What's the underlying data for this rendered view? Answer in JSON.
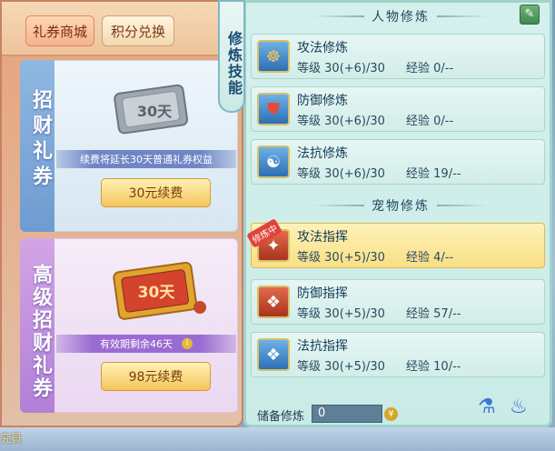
{
  "shop": {
    "tabs": [
      {
        "label": "礼券商城",
        "active": true
      },
      {
        "label": "积分兑换",
        "active": false
      }
    ],
    "cards": [
      {
        "title": "招财礼券",
        "ticket_text": "30天",
        "description": "续费将延长30天普通礼券权益",
        "button": "30元续费"
      },
      {
        "title": "高级招财礼券",
        "ticket_text": "30天",
        "description": "有效期剩余46天",
        "button": "98元续费"
      }
    ]
  },
  "skills": {
    "side_tab": "修炼技能",
    "person_header": "人物修炼",
    "pet_header": "宠物修炼",
    "person": [
      {
        "name": "攻法修炼",
        "level_label": "等级",
        "level": "30(+6)/30",
        "exp_label": "经验",
        "exp": "0/--",
        "icon": "meditate-icon"
      },
      {
        "name": "防御修炼",
        "level_label": "等级",
        "level": "30(+6)/30",
        "exp_label": "经验",
        "exp": "0/--",
        "icon": "shield-icon"
      },
      {
        "name": "法抗修炼",
        "level_label": "等级",
        "level": "30(+6)/30",
        "exp_label": "经验",
        "exp": "19/--",
        "icon": "yinyang-icon"
      }
    ],
    "pet": [
      {
        "name": "攻法指挥",
        "level_label": "等级",
        "level": "30(+5)/30",
        "exp_label": "经验",
        "exp": "4/--",
        "icon": "attack-command-icon",
        "badge": "修炼中",
        "selected": true
      },
      {
        "name": "防御指挥",
        "level_label": "等级",
        "level": "30(+5)/30",
        "exp_label": "经验",
        "exp": "57/--",
        "icon": "paw-shield-icon"
      },
      {
        "name": "法抗指挥",
        "level_label": "等级",
        "level": "30(+5)/30",
        "exp_label": "经验",
        "exp": "10/--",
        "icon": "paw-resist-icon"
      }
    ],
    "reserve_label": "储备修炼",
    "reserve_value": "0"
  },
  "ground_text": "究員",
  "colors": {
    "accent_gold": "#f4c65c",
    "panel_teal": "#c9ebe6",
    "selected_row": "#f8df86"
  }
}
